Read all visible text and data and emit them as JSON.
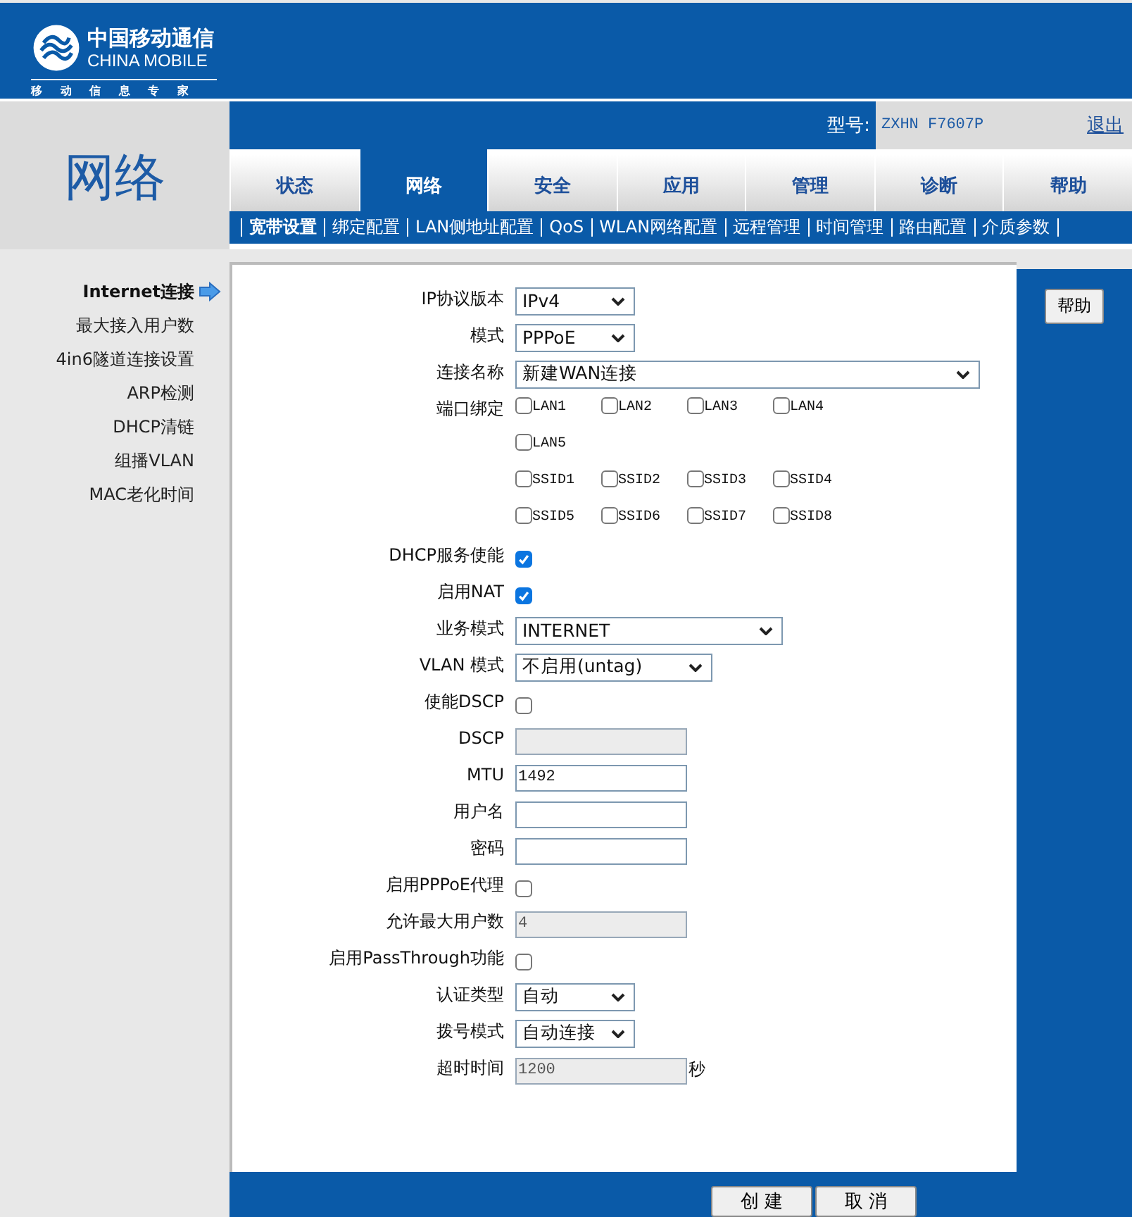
{
  "header": {
    "logo_cn": "中国移动通信",
    "logo_en": "CHINA MOBILE",
    "logo_slogan": "移 动 信 息 专 家"
  },
  "page_title": "网络",
  "model": {
    "label": "型号:",
    "value": "ZXHN F7607P"
  },
  "logout": "退出",
  "tabs": [
    {
      "label": "状态",
      "selected": false
    },
    {
      "label": "网络",
      "selected": true
    },
    {
      "label": "安全",
      "selected": false
    },
    {
      "label": "应用",
      "selected": false
    },
    {
      "label": "管理",
      "selected": false
    },
    {
      "label": "诊断",
      "selected": false
    },
    {
      "label": "帮助",
      "selected": false
    }
  ],
  "subnav": [
    {
      "label": "宽带设置",
      "selected": true
    },
    {
      "label": "绑定配置",
      "selected": false
    },
    {
      "label": "LAN侧地址配置",
      "selected": false
    },
    {
      "label": "QoS",
      "selected": false
    },
    {
      "label": "WLAN网络配置",
      "selected": false
    },
    {
      "label": "远程管理",
      "selected": false
    },
    {
      "label": "时间管理",
      "selected": false
    },
    {
      "label": "路由配置",
      "selected": false
    },
    {
      "label": "介质参数",
      "selected": false
    }
  ],
  "sidebar": {
    "items": [
      {
        "label": "Internet连接",
        "selected": true
      },
      {
        "label": "最大接入用户数",
        "selected": false
      },
      {
        "label": "4in6隧道连接设置",
        "selected": false
      },
      {
        "label": "ARP检测",
        "selected": false
      },
      {
        "label": "DHCP清链",
        "selected": false
      },
      {
        "label": "组播VLAN",
        "selected": false
      },
      {
        "label": "MAC老化时间",
        "selected": false
      }
    ]
  },
  "form": [
    {
      "kind": "select",
      "label": "IP协议版本",
      "value": "IPv4"
    },
    {
      "kind": "select",
      "label": "模式",
      "value": "PPPoE"
    },
    {
      "kind": "select",
      "label": "连接名称",
      "value": "新建WAN连接"
    },
    {
      "kind": "ports",
      "label": "端口绑定",
      "lines": [
        [
          {
            "label": "LAN1",
            "checked": false
          },
          {
            "label": "LAN2",
            "checked": false
          },
          {
            "label": "LAN3",
            "checked": false
          },
          {
            "label": "LAN4",
            "checked": false
          }
        ],
        [
          {
            "label": "LAN5",
            "checked": false
          }
        ],
        [
          {
            "label": "SSID1",
            "checked": false
          },
          {
            "label": "SSID2",
            "checked": false
          },
          {
            "label": "SSID3",
            "checked": false
          },
          {
            "label": "SSID4",
            "checked": false
          }
        ],
        [
          {
            "label": "SSID5",
            "checked": false
          },
          {
            "label": "SSID6",
            "checked": false
          },
          {
            "label": "SSID7",
            "checked": false
          },
          {
            "label": "SSID8",
            "checked": false
          }
        ]
      ]
    },
    {
      "kind": "checkbox",
      "label": "DHCP服务使能",
      "checked": true
    },
    {
      "kind": "checkbox",
      "label": "启用NAT",
      "checked": true
    },
    {
      "kind": "select",
      "label": "业务模式",
      "value": "INTERNET"
    },
    {
      "kind": "select",
      "label": "VLAN 模式",
      "value": "不启用(untag)"
    },
    {
      "kind": "checkbox",
      "label": "使能DSCP",
      "checked": false
    },
    {
      "kind": "input",
      "label": "DSCP",
      "disabled": true
    },
    {
      "kind": "input",
      "label": "MTU",
      "value": "1492",
      "disabled": false
    },
    {
      "kind": "input",
      "label": "用户名",
      "disabled": false
    },
    {
      "kind": "input",
      "label": "密码",
      "disabled": false
    },
    {
      "kind": "checkbox",
      "label": "启用PPPoE代理",
      "checked": false
    },
    {
      "kind": "input",
      "label": "允许最大用户数",
      "value": "4",
      "disabled": true
    },
    {
      "kind": "checkbox",
      "label": "启用PassThrough功能",
      "checked": false
    },
    {
      "kind": "select",
      "label": "认证类型",
      "value": "自动"
    },
    {
      "kind": "select",
      "label": "拨号模式",
      "value": "自动连接"
    },
    {
      "kind": "input",
      "label": "超时时间",
      "value": "1200",
      "disabled": true,
      "suffix": "秒"
    }
  ],
  "help_button": "帮助",
  "buttons": [
    "创 建",
    "取 消"
  ]
}
